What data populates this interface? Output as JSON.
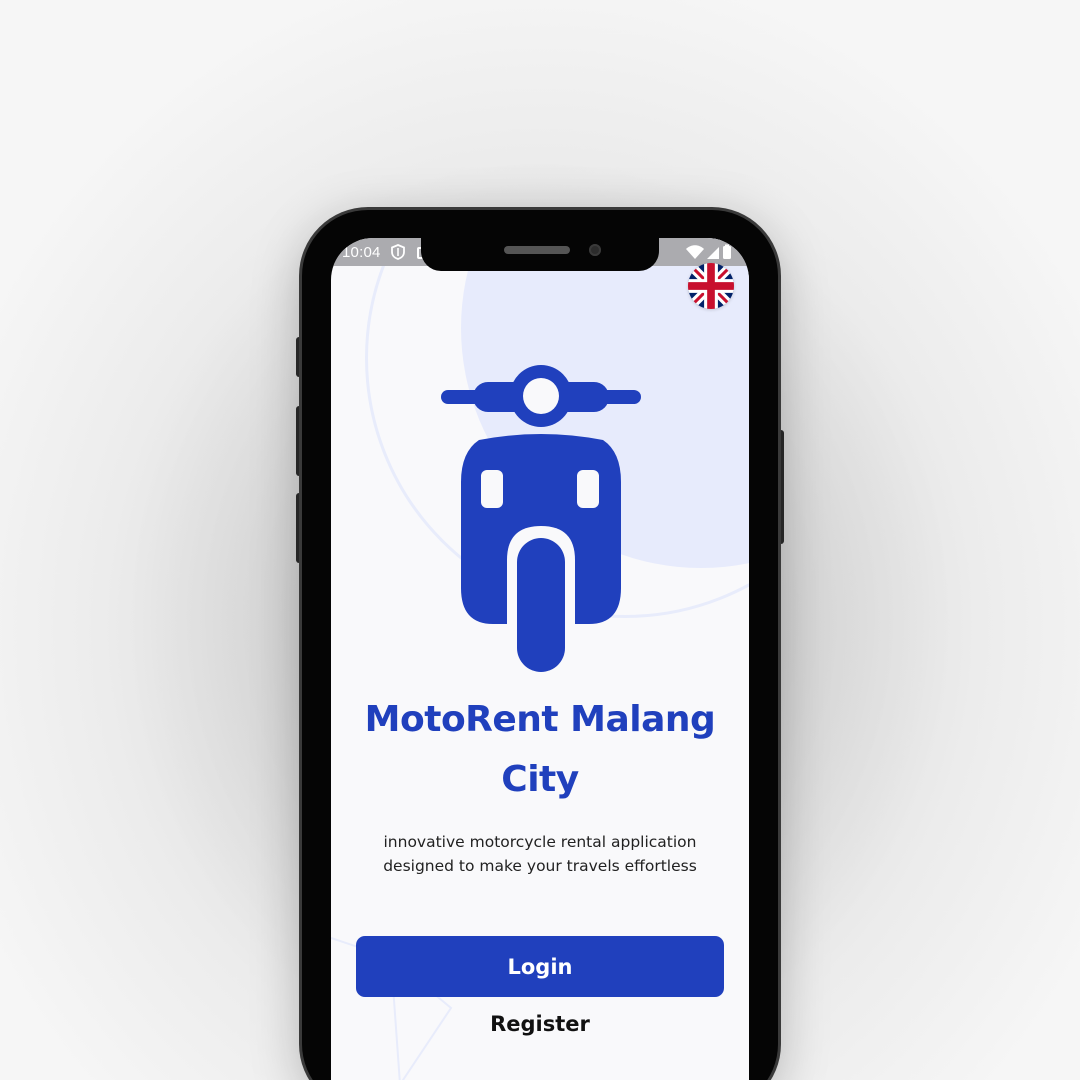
{
  "status_bar": {
    "time": "10:04"
  },
  "app": {
    "title_line1": "MotoRent Malang",
    "title_line2": "City",
    "tagline_line1": "innovative motorcycle rental application",
    "tagline_line2": "designed to make your travels effortless"
  },
  "actions": {
    "login_label": "Login",
    "register_label": "Register"
  },
  "language": {
    "current": "uk-flag-icon"
  },
  "colors": {
    "brand_blue": "#2040bd",
    "deco_blue": "#e7ebfc",
    "background": "#f9f9fb"
  },
  "icons": {
    "logo": "scooter-icon",
    "status_shield": "shield-icon",
    "wifi": "wifi-icon",
    "signal": "signal-icon",
    "battery": "battery-icon"
  }
}
